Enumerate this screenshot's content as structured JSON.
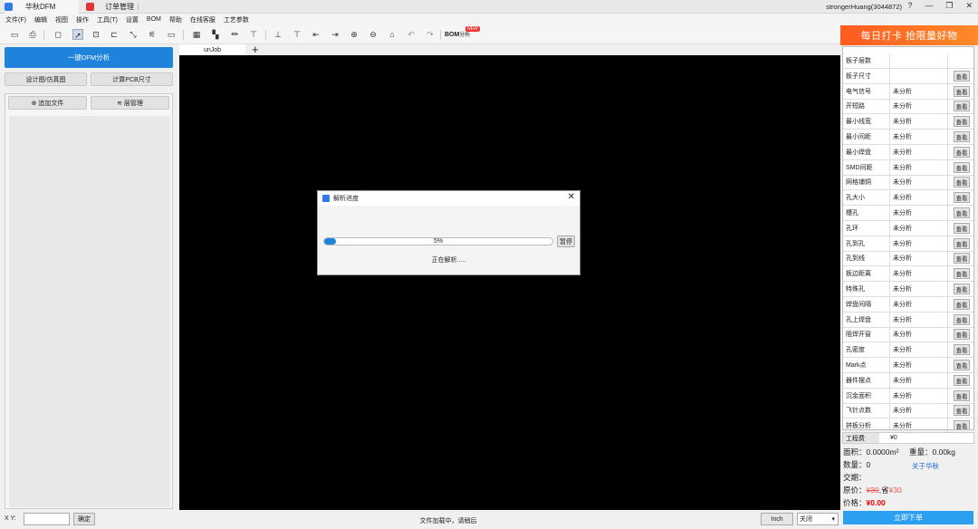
{
  "tabs": [
    {
      "label": "华秋DFM"
    },
    {
      "label": "订单管理"
    }
  ],
  "user": "strongerHuang(3044872)",
  "window_buttons": {
    "help": "?",
    "min": "—",
    "restore": "❐",
    "close": "✕"
  },
  "menu": [
    "文件(F)",
    "编辑",
    "视图",
    "操作",
    "工具(T)",
    "设置",
    "BOM",
    "帮助",
    "在线客服",
    "工艺参数"
  ],
  "toolbar": {
    "bom_label": "BOM",
    "bom_sub": "分析",
    "new_badge": "NEW"
  },
  "promo": "每日打卡 抢限量好物",
  "left": {
    "dfm_button": "一键DFM分析",
    "design_button": "设计图/仿真图",
    "pcb_size_button": "计算PCB尺寸",
    "add_file_button": "追加文件",
    "layer_button": "层管理"
  },
  "canvas": {
    "job_tab": "unJob",
    "add_tab": "+"
  },
  "dialog": {
    "title": "解析进度",
    "close": "✕",
    "progress_percent": 5,
    "progress_text": "5%",
    "pause_button": "暂停",
    "status": "正在解析....."
  },
  "analysis": {
    "view_label": "查看",
    "rows": [
      {
        "name": "板子层数",
        "status": "",
        "button": false
      },
      {
        "name": "板子尺寸",
        "status": "",
        "button": true
      },
      {
        "name": "电气信号",
        "status": "未分析",
        "button": true
      },
      {
        "name": "开短路",
        "status": "未分析",
        "button": true
      },
      {
        "name": "最小线宽",
        "status": "未分析",
        "button": true
      },
      {
        "name": "最小间距",
        "status": "未分析",
        "button": true
      },
      {
        "name": "最小焊盘",
        "status": "未分析",
        "button": true
      },
      {
        "name": "SMD间距",
        "status": "未分析",
        "button": true
      },
      {
        "name": "网格铺铜",
        "status": "未分析",
        "button": true
      },
      {
        "name": "孔大小",
        "status": "未分析",
        "button": true
      },
      {
        "name": "槽孔",
        "status": "未分析",
        "button": true
      },
      {
        "name": "孔环",
        "status": "未分析",
        "button": true
      },
      {
        "name": "孔到孔",
        "status": "未分析",
        "button": true
      },
      {
        "name": "孔到线",
        "status": "未分析",
        "button": true
      },
      {
        "name": "板边距离",
        "status": "未分析",
        "button": true
      },
      {
        "name": "特殊孔",
        "status": "未分析",
        "button": true
      },
      {
        "name": "焊盘间隔",
        "status": "未分析",
        "button": true
      },
      {
        "name": "孔上焊盘",
        "status": "未分析",
        "button": true
      },
      {
        "name": "阻焊开窗",
        "status": "未分析",
        "button": true
      },
      {
        "name": "孔密度",
        "status": "未分析",
        "button": true
      },
      {
        "name": "Mark点",
        "status": "未分析",
        "button": true
      },
      {
        "name": "器件摆点",
        "status": "未分析",
        "button": true
      },
      {
        "name": "沉金面积",
        "status": "未分析",
        "button": true
      },
      {
        "name": "飞针点数",
        "status": "未分析",
        "button": true
      },
      {
        "name": "拼板分析",
        "status": "未分析",
        "button": true
      }
    ]
  },
  "quote": {
    "eng_label": "工程费",
    "eng_value": "¥0",
    "area": "面积：0.0000m²",
    "weight": "重量：0.00kg",
    "qty": "数量：0",
    "about": "关于华秋",
    "delivery": "交期：",
    "orig_label": "原价：",
    "orig_value": "¥30",
    "save_label": ",省",
    "save_value": "¥30",
    "price_label": "价格：",
    "price_value": "¥0.00",
    "order_button": "立即下单"
  },
  "status": {
    "xy_label": "X Y:",
    "confirm": "确定",
    "loading": "文件加载中，请稍后",
    "unit": "Inch",
    "close_select": "关闭",
    "dropdown": "▾"
  }
}
